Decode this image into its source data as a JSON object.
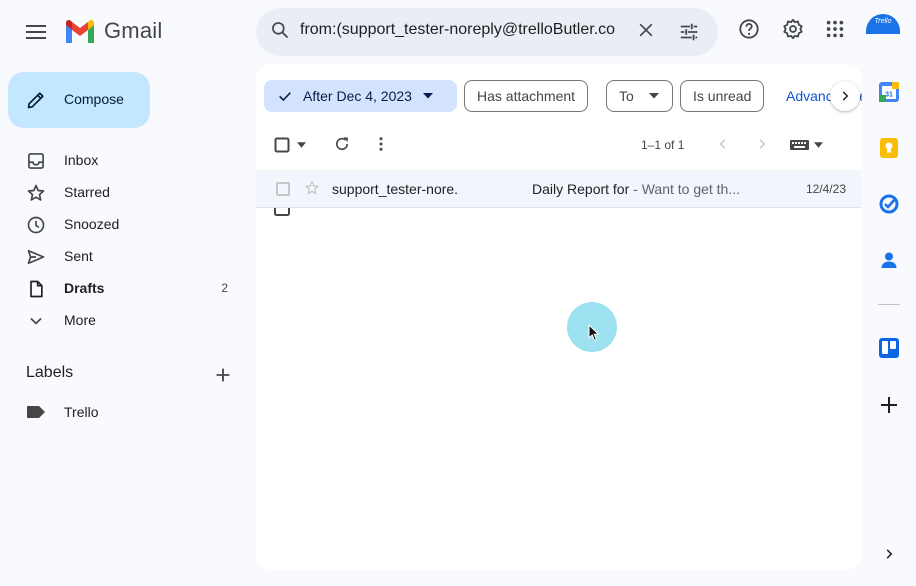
{
  "app": {
    "name": "Gmail",
    "logo_text": "Gmail"
  },
  "search": {
    "query": "from:(support_tester-noreply@trelloButler.co"
  },
  "compose": {
    "label": "Compose"
  },
  "sidebar": {
    "items": [
      {
        "label": "Inbox",
        "icon": "inbox-icon",
        "count": ""
      },
      {
        "label": "Starred",
        "icon": "star-icon",
        "count": ""
      },
      {
        "label": "Snoozed",
        "icon": "clock-icon",
        "count": ""
      },
      {
        "label": "Sent",
        "icon": "send-icon",
        "count": ""
      },
      {
        "label": "Drafts",
        "icon": "draft-icon",
        "count": "2"
      },
      {
        "label": "More",
        "icon": "chevron-down-icon",
        "count": ""
      }
    ],
    "labels_heading": "Labels",
    "labels": [
      {
        "label": "Trello",
        "icon": "label-icon"
      }
    ]
  },
  "filters": {
    "chips": [
      {
        "label": "After Dec 4, 2023",
        "active": true
      },
      {
        "label": "Has attachment",
        "active": false
      },
      {
        "label": "To",
        "active": false
      },
      {
        "label": "Is unread",
        "active": false
      }
    ],
    "advanced_label": "Advanced search"
  },
  "toolbar": {
    "pagination": "1–1 of 1"
  },
  "messages": [
    {
      "sender": "support_tester-nore.",
      "subject": "Daily Report for",
      "snippet": " - Want to get th...",
      "date": "12/4/23"
    }
  ],
  "avatar_text": "Trello",
  "colors": {
    "background": "#f8fafd",
    "compose": "#c2e7ff",
    "active_chip": "#d3e3fd",
    "row_bg": "#f2f6fc",
    "link": "#0b57d0",
    "cursor_halo": "#7dd7eb"
  }
}
